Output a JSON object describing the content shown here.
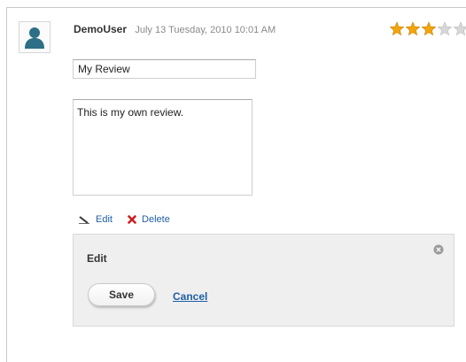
{
  "review": {
    "username": "DemoUser",
    "timestamp": "July 13 Tuesday, 2010 10:01 AM",
    "rating": 3,
    "max_rating": 5,
    "title_value": "My Review",
    "body_value": "This is my own review."
  },
  "actions": {
    "edit_label": "Edit",
    "delete_label": "Delete"
  },
  "edit_panel": {
    "title": "Edit",
    "save_label": "Save",
    "cancel_label": "Cancel"
  },
  "icons": {
    "avatar": "user-avatar-icon",
    "star": "star-icon",
    "edit": "pencil-icon",
    "delete": "x-icon",
    "close": "close-circle-icon"
  },
  "colors": {
    "link": "#1f5fa6",
    "star_filled": "#f3a510",
    "star_empty": "#d8d8d8",
    "delete": "#cc1f1f",
    "avatar": "#2c6f86"
  }
}
